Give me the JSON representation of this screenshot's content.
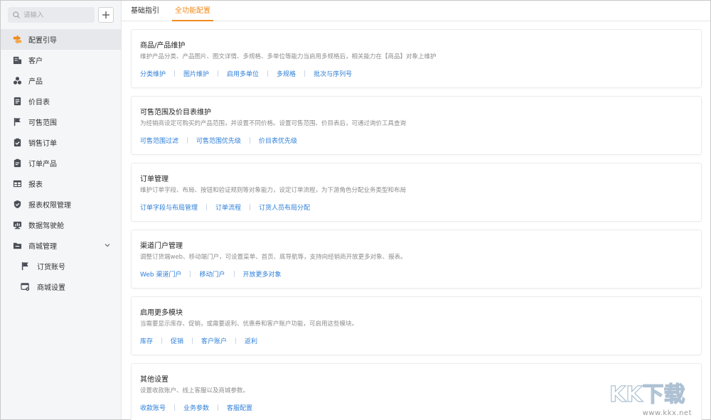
{
  "search": {
    "placeholder": "请输入"
  },
  "sidebar": {
    "items": [
      {
        "label": "配置引导",
        "icon": "guide-icon",
        "active": true
      },
      {
        "label": "客户",
        "icon": "building-icon"
      },
      {
        "label": "产品",
        "icon": "product-icon"
      },
      {
        "label": "价目表",
        "icon": "price-list-icon"
      },
      {
        "label": "可售范围",
        "icon": "flag-icon"
      },
      {
        "label": "销售订单",
        "icon": "clipboard-check-icon"
      },
      {
        "label": "订单产品",
        "icon": "order-product-icon"
      },
      {
        "label": "报表",
        "icon": "table-icon"
      },
      {
        "label": "报表权限管理",
        "icon": "shield-icon"
      },
      {
        "label": "数据驾驶舱",
        "icon": "dashboard-icon"
      },
      {
        "label": "商城管理",
        "icon": "folder-icon",
        "expanded": true
      },
      {
        "label": "订货账号",
        "icon": "flag-icon",
        "sub": true
      },
      {
        "label": "商城设置",
        "icon": "store-settings-icon",
        "sub": true
      }
    ]
  },
  "tabs": [
    {
      "label": "基础指引",
      "active": false
    },
    {
      "label": "全功能配置",
      "active": true
    }
  ],
  "cards": [
    {
      "title": "商品/产品维护",
      "desc": "维护产品分类、产品图片、图文详情、多规格、多单位等能力当启用多规格后，相关能力在【商品】对象上维护",
      "links": [
        "分类维护",
        "图片维护",
        "启用多单位",
        "多规格",
        "批次与序列号"
      ]
    },
    {
      "title": "可售范围及价目表维护",
      "desc": "为经销商设定可购买的产品范围，并设置不同价格。设置可售范围、价目表后，可通过询价工具查询",
      "links": [
        "可售范围过滤",
        "可售范围优先级",
        "价目表优先级"
      ]
    },
    {
      "title": "订单管理",
      "desc": "维护订单字段、布局、按钮和验证规则等对象能力，设定订单流程，为下游角色分配业务类型和布局",
      "links": [
        "订单字段与布局管理",
        "订单流程",
        "订货人员布局分配"
      ]
    },
    {
      "title": "渠道门户管理",
      "desc": "调整订货端web、移动端门户，可设置菜单、首页、底导航等，支持向经销商开放更多对象、报表。",
      "links": [
        "Web 渠道门户",
        "移动门户",
        "开放更多对象"
      ]
    },
    {
      "title": "启用更多模块",
      "desc": "当需要显示库存、促销，或需要返利、优惠券和客户账户功能，可启用这些模块。",
      "links": [
        "库存",
        "促销",
        "客户账户",
        "返利"
      ]
    },
    {
      "title": "其他设置",
      "desc": "设置收款账户、线上客服以及商城参数。",
      "links": [
        "收款账号",
        "业务参数",
        "客服配置"
      ]
    }
  ],
  "watermark": {
    "text": "KK下载",
    "url": "www.kkx.net"
  },
  "colors": {
    "accent": "#f08a1c",
    "link": "#2d7fd9"
  }
}
